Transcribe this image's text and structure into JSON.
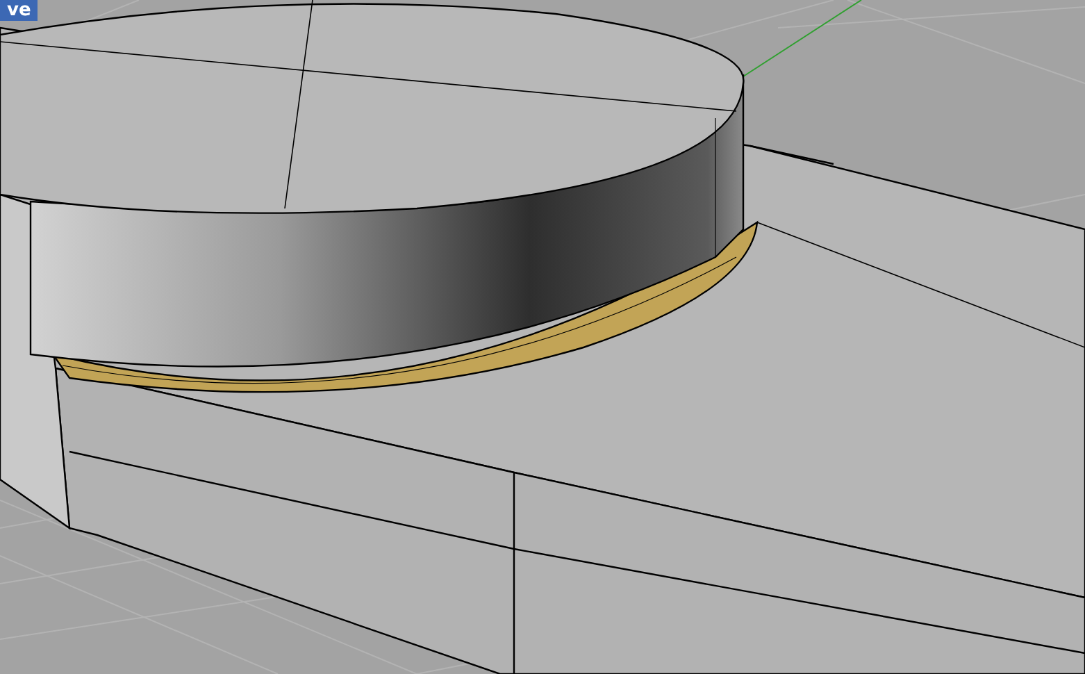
{
  "viewport": {
    "label": "ve"
  }
}
